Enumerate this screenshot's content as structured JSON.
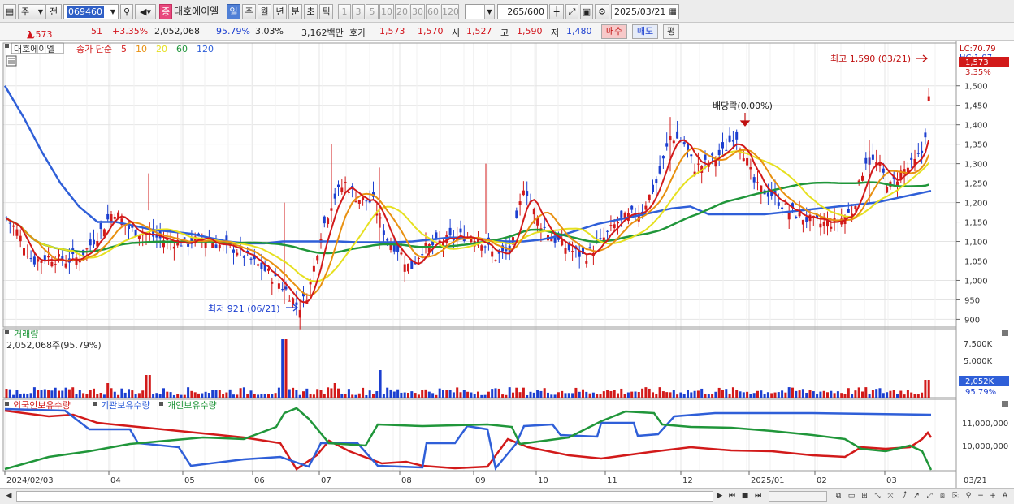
{
  "toolbar": {
    "market": "주",
    "exchange": "전",
    "stock_code": "069460",
    "stock_name": "대호에이엘",
    "stock_type_icon": "종",
    "periods": [
      "일",
      "주",
      "월",
      "년",
      "분",
      "초",
      "틱"
    ],
    "active_period": "일",
    "intervals": [
      "1",
      "3",
      "5",
      "10",
      "20",
      "30",
      "60",
      "120"
    ],
    "count": "265",
    "count_total": "/600",
    "date": "2025/03/21"
  },
  "quote": {
    "price": "1,573",
    "change_arrow": "▲",
    "change": "51",
    "change_pct": "+3.35%",
    "volume": "2,052,068",
    "volume_ratio": "95.79%",
    "turnover": "3.03%",
    "amount": "3,162백만",
    "bid_label": "호가",
    "ask_price": "1,573",
    "bid_price": "1,570",
    "open_label": "시",
    "open": "1,527",
    "high_label": "고",
    "high": "1,590",
    "low_label": "저",
    "low": "1,480",
    "buy_button": "매수",
    "sell_button": "매도",
    "eval_button": "평"
  },
  "price_panel": {
    "legend_name": "대호에이엘",
    "legend_ma_label": "종가 단순",
    "ma_periods": [
      {
        "label": "5",
        "color": "#d21a1a"
      },
      {
        "label": "10",
        "color": "#e89010"
      },
      {
        "label": "20",
        "color": "#e6e020"
      },
      {
        "label": "60",
        "color": "#20963a"
      },
      {
        "label": "120",
        "color": "#2f5fd8"
      }
    ],
    "y_ticks": [
      "1,500",
      "1,450",
      "1,400",
      "1,350",
      "1,300",
      "1,250",
      "1,200",
      "1,150",
      "1,100",
      "1,050",
      "1,000",
      "950",
      "900"
    ],
    "y_tick_values": [
      1500,
      1450,
      1400,
      1350,
      1300,
      1250,
      1200,
      1150,
      1100,
      1050,
      1000,
      950,
      900
    ],
    "lc_label": "LC:70.79",
    "hc_label": "HC:1.07",
    "current_price_tag": "1,573",
    "change_tag": "3.35%",
    "high_annotation": "최고 1,590 (03/21)",
    "low_annotation": "최저 921 (06/21)",
    "dividend_annotation": "배당락(0.00%)"
  },
  "volume_panel": {
    "title": "거래량",
    "value": "2,052,068주(95.79%)",
    "y_ticks": [
      "7,500K",
      "5,000K"
    ],
    "current_tag": "2,052K",
    "ratio_tag": "95.79%"
  },
  "holdings_panel": {
    "legend": [
      {
        "label": "외국인보유수량",
        "color": "#d21a1a"
      },
      {
        "label": "기관보유수량",
        "color": "#2f5fd8"
      },
      {
        "label": "개인보유수량",
        "color": "#20963a"
      }
    ],
    "y_ticks": [
      "11,000,000",
      "10,000,000"
    ]
  },
  "x_axis": {
    "labels": [
      "2024/02/03",
      "04",
      "05",
      "06",
      "07",
      "08",
      "09",
      "10",
      "11",
      "12",
      "2025/01",
      "02",
      "03"
    ],
    "current_date": "03/21"
  },
  "chart_data": {
    "type": "line",
    "candles_approx": "daily candlesticks 2024/02/03 - 2025/03/21",
    "price_range": [
      880,
      1610
    ],
    "high": {
      "value": 1590,
      "date": "03/21"
    },
    "low": {
      "value": 921,
      "date": "06/21"
    },
    "series": [
      {
        "name": "5",
        "values_approx": [
          1170,
          1090,
          1050,
          1040,
          1110,
          1180,
          1160,
          1120,
          1100,
          1090,
          1060,
          1010,
          960,
          940,
          1050,
          1200,
          1230,
          1190,
          1050,
          1020,
          1080,
          1110,
          1120,
          1080,
          1070,
          1230,
          1150,
          1090,
          1060,
          1080,
          1150,
          1200,
          1280,
          1360,
          1340,
          1300,
          1310,
          1380,
          1350,
          1240,
          1180,
          1170,
          1150,
          1150,
          1190,
          1300,
          1280,
          1260,
          1300,
          1340,
          1430
        ]
      },
      {
        "name": "120",
        "values_approx": [
          1500,
          1420,
          1330,
          1250,
          1190,
          1150,
          1150,
          1140,
          1130,
          1125,
          1120,
          1110,
          1100,
          1095,
          1095,
          1100,
          1100,
          1100,
          1100,
          1098,
          1098,
          1098,
          1100,
          1105,
          1110,
          1110,
          1105,
          1100,
          1100,
          1105,
          1115,
          1130,
          1145,
          1155,
          1165,
          1175,
          1185,
          1190,
          1170,
          1170,
          1170,
          1170,
          1175,
          1180,
          1185,
          1190,
          1195,
          1200,
          1210,
          1220,
          1230
        ]
      }
    ],
    "volume_spike_dates": [
      "06/21",
      "07/23"
    ]
  }
}
